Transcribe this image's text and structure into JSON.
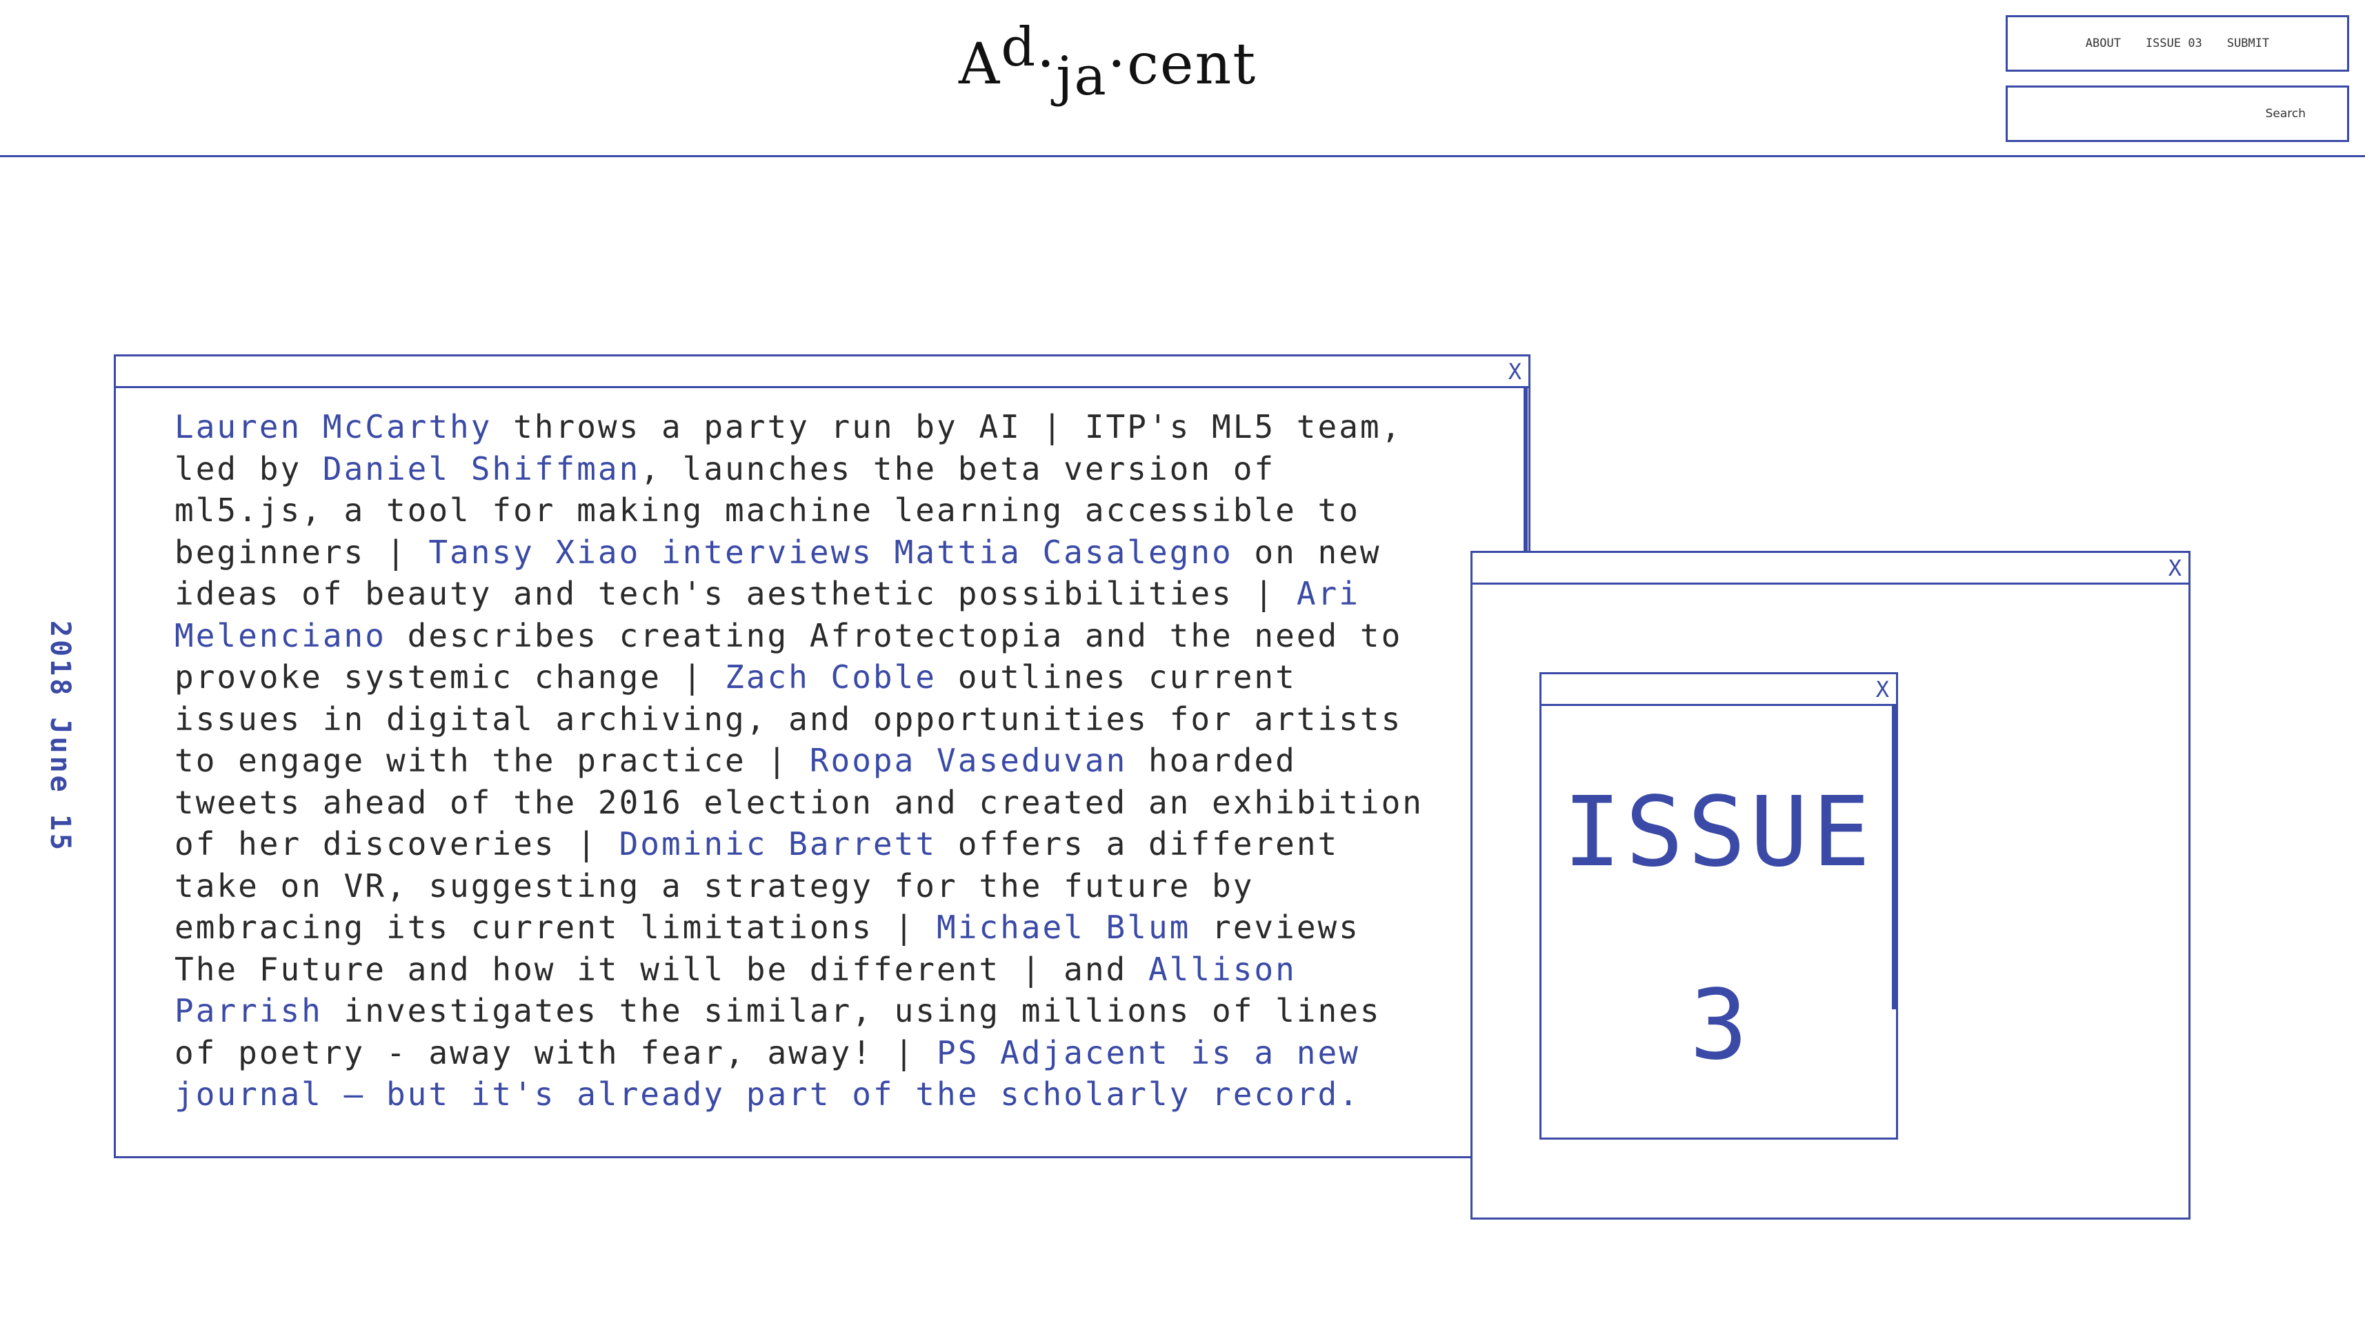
{
  "header": {
    "logo": {
      "part1": "A",
      "part2": "d",
      "part3": "·",
      "part4": "ja",
      "part5": "·cent"
    },
    "nav": {
      "about": "ABOUT",
      "issue": "ISSUE 03",
      "submit": "SUBMIT"
    },
    "search": {
      "placeholder": "Search"
    }
  },
  "date": "2018 June 15",
  "main_window": {
    "close": "X",
    "lines": [
      [
        {
          "t": "Lauren McCarthy",
          "l": true
        },
        {
          "t": " throws a party run by AI | ITP's ML5 team,"
        }
      ],
      [
        {
          "t": "led by "
        },
        {
          "t": "Daniel Shiffman",
          "l": true
        },
        {
          "t": ", launches the beta version of"
        }
      ],
      [
        {
          "t": "ml5.js, a tool for making machine learning accessible to"
        }
      ],
      [
        {
          "t": "beginners | "
        },
        {
          "t": "Tansy Xiao interviews Mattia Casalegno",
          "l": true
        },
        {
          "t": " on new"
        }
      ],
      [
        {
          "t": "ideas of beauty and tech's aesthetic possibilities | "
        },
        {
          "t": "Ari",
          "l": true
        }
      ],
      [
        {
          "t": "Melenciano",
          "l": true
        },
        {
          "t": " describes creating Afrotectopia and the need to"
        }
      ],
      [
        {
          "t": "provoke systemic change | "
        },
        {
          "t": "Zach Coble",
          "l": true
        },
        {
          "t": " outlines current"
        }
      ],
      [
        {
          "t": "issues in digital archiving, and opportunities for artists"
        }
      ],
      [
        {
          "t": "to engage with the practice | "
        },
        {
          "t": "Roopa Vaseduvan",
          "l": true
        },
        {
          "t": " hoarded"
        }
      ],
      [
        {
          "t": "tweets ahead of the 2016 election and created an exhibition"
        }
      ],
      [
        {
          "t": "of her discoveries | "
        },
        {
          "t": "Dominic Barrett",
          "l": true
        },
        {
          "t": " offers a different"
        }
      ],
      [
        {
          "t": "take on VR, suggesting a strategy for the future by"
        }
      ],
      [
        {
          "t": "embracing its current limitations | "
        },
        {
          "t": "Michael Blum",
          "l": true
        },
        {
          "t": " reviews"
        }
      ],
      [
        {
          "t": "The Future and how it will be different | and "
        },
        {
          "t": "Allison",
          "l": true
        }
      ],
      [
        {
          "t": "Parrish",
          "l": true
        },
        {
          "t": " investigates the similar, using millions of lines"
        }
      ],
      [
        {
          "t": "of poetry - away with fear, away! | "
        },
        {
          "t": "PS Adjacent is a new",
          "l": true
        }
      ],
      [
        {
          "t": "journal — but it's already part of the scholarly record.",
          "l": true
        }
      ]
    ]
  },
  "window2": {
    "close": "X"
  },
  "window3": {
    "close": "X",
    "title": "ISSUE",
    "number": "3"
  },
  "colors": {
    "accent": "#3a4aa6",
    "text": "#2a2a2a",
    "background": "#ffffff"
  }
}
